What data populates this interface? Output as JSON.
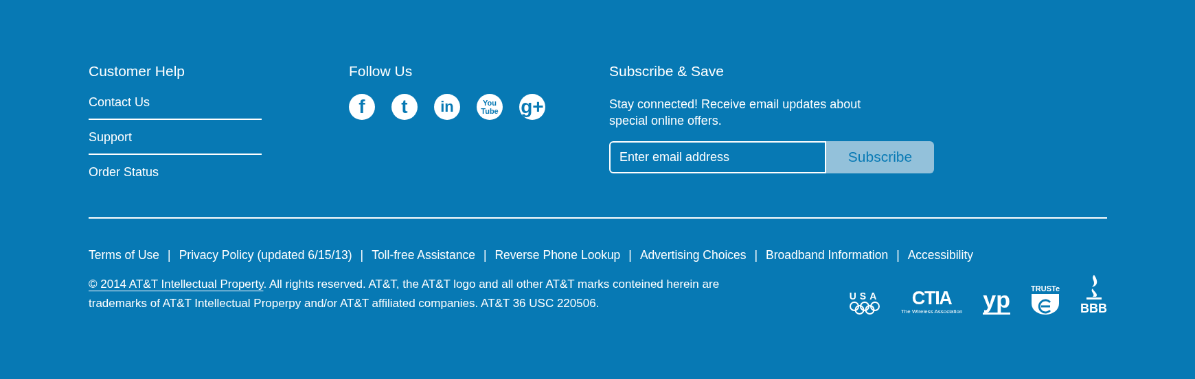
{
  "customer_help": {
    "heading": "Customer Help",
    "links": [
      "Contact Us",
      "Support",
      "Order Status"
    ]
  },
  "follow_us": {
    "heading": "Follow Us",
    "icons": [
      {
        "kind": "facebook",
        "glyph": "f"
      },
      {
        "kind": "twitter",
        "glyph": "t"
      },
      {
        "kind": "linkedin",
        "glyph": "in"
      },
      {
        "kind": "youtube",
        "lines": [
          "You",
          "Tube"
        ]
      },
      {
        "kind": "googleplus",
        "glyph": "g+"
      }
    ]
  },
  "subscribe": {
    "heading": "Subscribe & Save",
    "text": "Stay connected! Receive email updates about special online offers.",
    "placeholder": "Enter email address",
    "button": "Subscribe"
  },
  "legal_separator": "|",
  "legal_links": [
    "Terms of Use",
    "Privacy Policy (updated 6/15/13)",
    "Toll-free Assistance",
    "Reverse Phone Lookup",
    "Advertising Choices",
    "Broadband Information",
    "Accessibility"
  ],
  "copyright": {
    "link": "© 2014 AT&T Intellectual Property",
    "text": ". All rights reserved. AT&T, the AT&T logo and all other AT&T marks conteined herein are trademarks of AT&T Intellectual Properpy and/or AT&T affiliated companies. AT&T 36 USC 220506."
  },
  "badges": [
    {
      "kind": "usa",
      "text": "USA"
    },
    {
      "kind": "ctia",
      "text": "CTIA",
      "sub": "The Wireless Association"
    },
    {
      "kind": "yp",
      "text": "yp"
    },
    {
      "kind": "truste",
      "text": "TRUSTe"
    },
    {
      "kind": "bbb",
      "text": "BBB"
    }
  ]
}
